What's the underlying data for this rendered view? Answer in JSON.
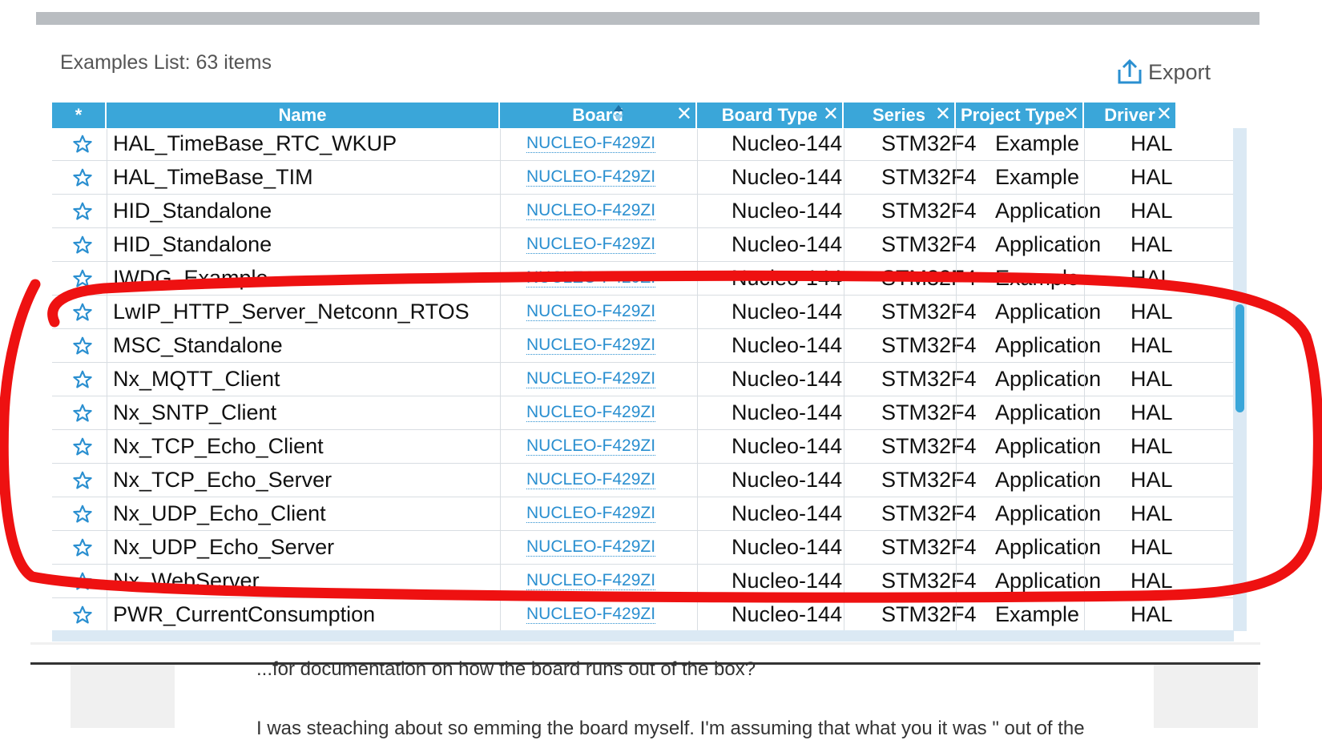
{
  "list_title": "Examples List: 63 items",
  "export_label": "Export",
  "headers": {
    "star": "*",
    "name": "Name",
    "board": "Board",
    "board_type": "Board Type",
    "series": "Series",
    "project_type": "Project Type",
    "driver": "Driver"
  },
  "rows": [
    {
      "name": "HAL_TimeBase_RTC_WKUP",
      "board": "NUCLEO-F429ZI",
      "board_type": "Nucleo-144",
      "series": "STM32F4",
      "project_type": "Example",
      "driver": "HAL"
    },
    {
      "name": "HAL_TimeBase_TIM",
      "board": "NUCLEO-F429ZI",
      "board_type": "Nucleo-144",
      "series": "STM32F4",
      "project_type": "Example",
      "driver": "HAL"
    },
    {
      "name": "HID_Standalone",
      "board": "NUCLEO-F429ZI",
      "board_type": "Nucleo-144",
      "series": "STM32F4",
      "project_type": "Application",
      "driver": "HAL"
    },
    {
      "name": "HID_Standalone",
      "board": "NUCLEO-F429ZI",
      "board_type": "Nucleo-144",
      "series": "STM32F4",
      "project_type": "Application",
      "driver": "HAL"
    },
    {
      "name": "IWDG_Example",
      "board": "NUCLEO-F429ZI",
      "board_type": "Nucleo-144",
      "series": "STM32F4",
      "project_type": "Example",
      "driver": "HAL"
    },
    {
      "name": "LwIP_HTTP_Server_Netconn_RTOS",
      "board": "NUCLEO-F429ZI",
      "board_type": "Nucleo-144",
      "series": "STM32F4",
      "project_type": "Application",
      "driver": "HAL"
    },
    {
      "name": "MSC_Standalone",
      "board": "NUCLEO-F429ZI",
      "board_type": "Nucleo-144",
      "series": "STM32F4",
      "project_type": "Application",
      "driver": "HAL"
    },
    {
      "name": "Nx_MQTT_Client",
      "board": "NUCLEO-F429ZI",
      "board_type": "Nucleo-144",
      "series": "STM32F4",
      "project_type": "Application",
      "driver": "HAL"
    },
    {
      "name": "Nx_SNTP_Client",
      "board": "NUCLEO-F429ZI",
      "board_type": "Nucleo-144",
      "series": "STM32F4",
      "project_type": "Application",
      "driver": "HAL"
    },
    {
      "name": "Nx_TCP_Echo_Client",
      "board": "NUCLEO-F429ZI",
      "board_type": "Nucleo-144",
      "series": "STM32F4",
      "project_type": "Application",
      "driver": "HAL"
    },
    {
      "name": "Nx_TCP_Echo_Server",
      "board": "NUCLEO-F429ZI",
      "board_type": "Nucleo-144",
      "series": "STM32F4",
      "project_type": "Application",
      "driver": "HAL"
    },
    {
      "name": "Nx_UDP_Echo_Client",
      "board": "NUCLEO-F429ZI",
      "board_type": "Nucleo-144",
      "series": "STM32F4",
      "project_type": "Application",
      "driver": "HAL"
    },
    {
      "name": "Nx_UDP_Echo_Server",
      "board": "NUCLEO-F429ZI",
      "board_type": "Nucleo-144",
      "series": "STM32F4",
      "project_type": "Application",
      "driver": "HAL"
    },
    {
      "name": "Nx_WebServer",
      "board": "NUCLEO-F429ZI",
      "board_type": "Nucleo-144",
      "series": "STM32F4",
      "project_type": "Application",
      "driver": "HAL"
    },
    {
      "name": "PWR_CurrentConsumption",
      "board": "NUCLEO-F429ZI",
      "board_type": "Nucleo-144",
      "series": "STM32F4",
      "project_type": "Example",
      "driver": "HAL"
    }
  ],
  "below_text": "...for documentation on how the board runs out of the box?",
  "below_text_2": "I was steaching about so emming the board myself. I'm assuming that what you it was \" out of the",
  "colors": {
    "header_bg": "#3aa6d9",
    "link": "#2a8fd0",
    "annotation": "#ee1111"
  },
  "icons": {
    "favorite": "star-outline-icon",
    "export": "export-share-icon",
    "remove_column": "close-x-icon",
    "sort": "sort-arrows-icon"
  }
}
